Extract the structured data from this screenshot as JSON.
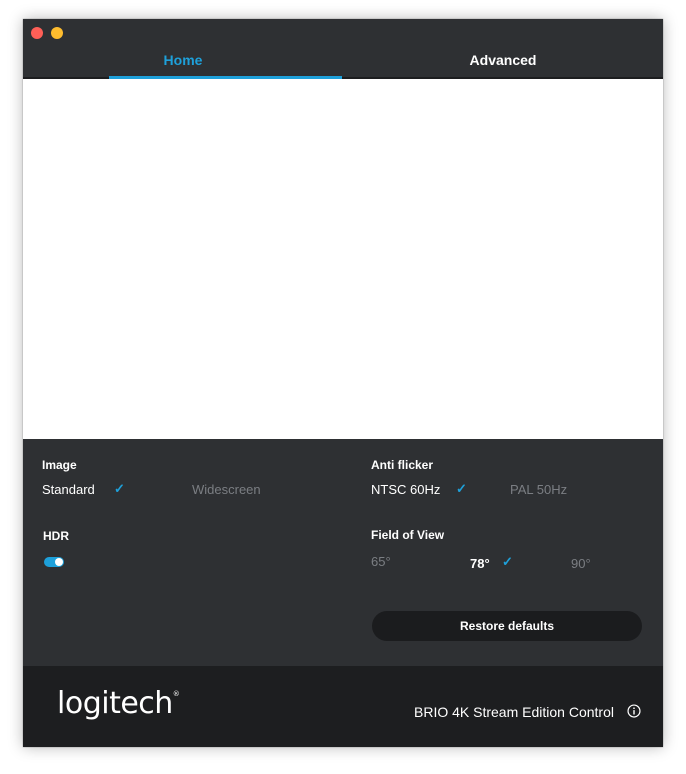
{
  "window": {
    "tabs": [
      {
        "label": "Home",
        "active": true
      },
      {
        "label": "Advanced",
        "active": false
      }
    ]
  },
  "image": {
    "label": "Image",
    "options": [
      {
        "label": "Standard",
        "selected": true
      },
      {
        "label": "Widescreen",
        "selected": false
      }
    ]
  },
  "hdr": {
    "label": "HDR",
    "enabled": true
  },
  "anti_flicker": {
    "label": "Anti flicker",
    "options": [
      {
        "label": "NTSC 60Hz",
        "selected": true
      },
      {
        "label": "PAL 50Hz",
        "selected": false
      }
    ]
  },
  "field_of_view": {
    "label": "Field of View",
    "options": [
      {
        "label": "65°",
        "selected": false
      },
      {
        "label": "78°",
        "selected": true
      },
      {
        "label": "90°",
        "selected": false
      }
    ]
  },
  "restore_label": "Restore defaults",
  "footer": {
    "brand": "logitech",
    "product": "BRIO 4K Stream Edition Control"
  },
  "colors": {
    "accent": "#1ea0da",
    "panel": "#2e3033",
    "footer": "#1d1e20",
    "button": "#1b1c1e"
  },
  "icons": {
    "check": "checkmark-icon",
    "info": "info-icon"
  }
}
